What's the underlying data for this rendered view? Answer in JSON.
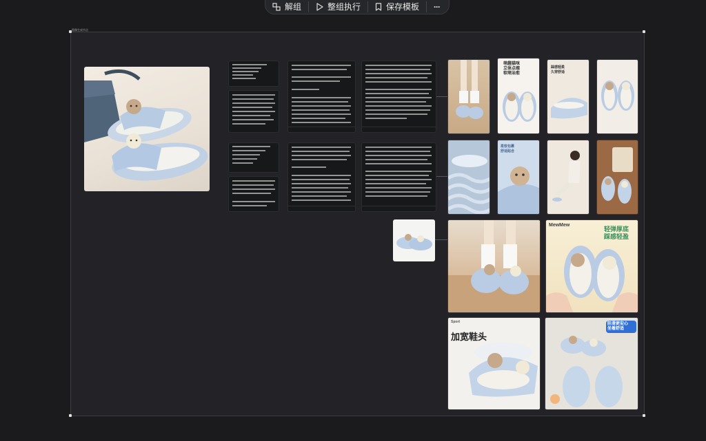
{
  "toolbar": {
    "ungroup_label": "解组",
    "run_group_label": "整组执行",
    "save_template_label": "保存模板",
    "more_label": "···"
  },
  "canvas": {
    "frame_title": "图像生成节点"
  },
  "tiles": {
    "t2_caption": "萌趣猫咪\n立体点缀\n软萌治愈",
    "t3_caption": "踩感轻柔\n久穿舒适",
    "t6_caption": "柔软包裹\n舒适贴合",
    "t11_caption": "轻弹厚底\n踩感轻盈",
    "t11_brand": "MewMew",
    "t12_caption": "加宽鞋头",
    "t12_brand": "Sport",
    "t13_caption": "防滑更安心\n坐着舒适"
  },
  "colors": {
    "background": "#1b1b1d",
    "frame": "#232327",
    "slipper": "#b9cce4",
    "accent_blue": "#2f6fd6"
  }
}
